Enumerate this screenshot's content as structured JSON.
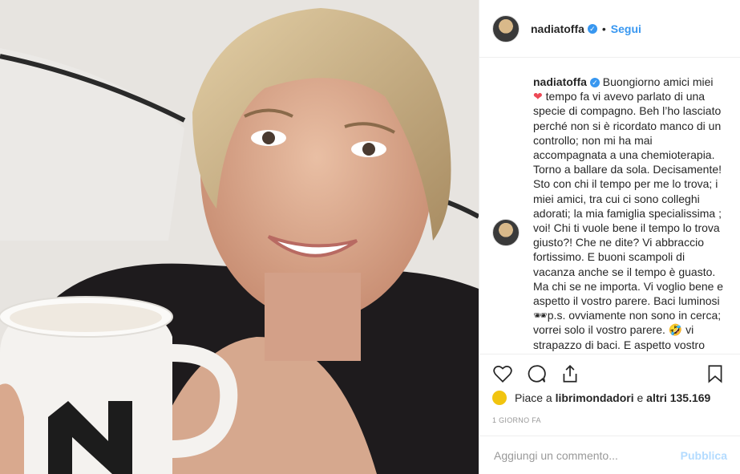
{
  "post": {
    "image_alt": "photo",
    "author": "nadiatoffa",
    "follow_label": "Segui",
    "separator": "•"
  },
  "caption": {
    "username": "nadiatoffa",
    "text_1": "Buongiorno amici miei",
    "heart": "❤",
    "text_2": " tempo fa vi avevo parlato di una specie di compagno. Beh l’ho lasciato perché non si è ricordato manco di un controllo; non mi ha mai accompagnata a una chemioterapia. Torno a ballare da sola. Decisamente! Sto con chi il tempo per me lo trova; i miei amici, tra cui ci sono colleghi adorati; la mia famiglia specialissima ; voi! Chi ti vuole bene il tempo lo trova giusto?! Che ne dite? Vi abbraccio fortissimo. E buoni scampoli di vacanza anche se il tempo è guasto. Ma chi se ne importa. Vi voglio bene e aspetto il vostro parere. Baci luminosi 🕶p.s. ovviamente non sono in cerca; vorrei solo il vostro parere. 🤣 vi strapazzo di baci. E aspetto vostro"
  },
  "likes": {
    "prefix": "Piace a",
    "user": "librimondadori",
    "middle": "e",
    "others": "altri 135.169"
  },
  "time_ago": "1 GIORNO FA",
  "comment_box": {
    "placeholder": "Aggiungi un commento...",
    "publish_label": "Pubblica"
  },
  "colors": {
    "accent": "#3897f0",
    "heart": "#ed4956",
    "publish_disabled": "#b3dbff"
  }
}
